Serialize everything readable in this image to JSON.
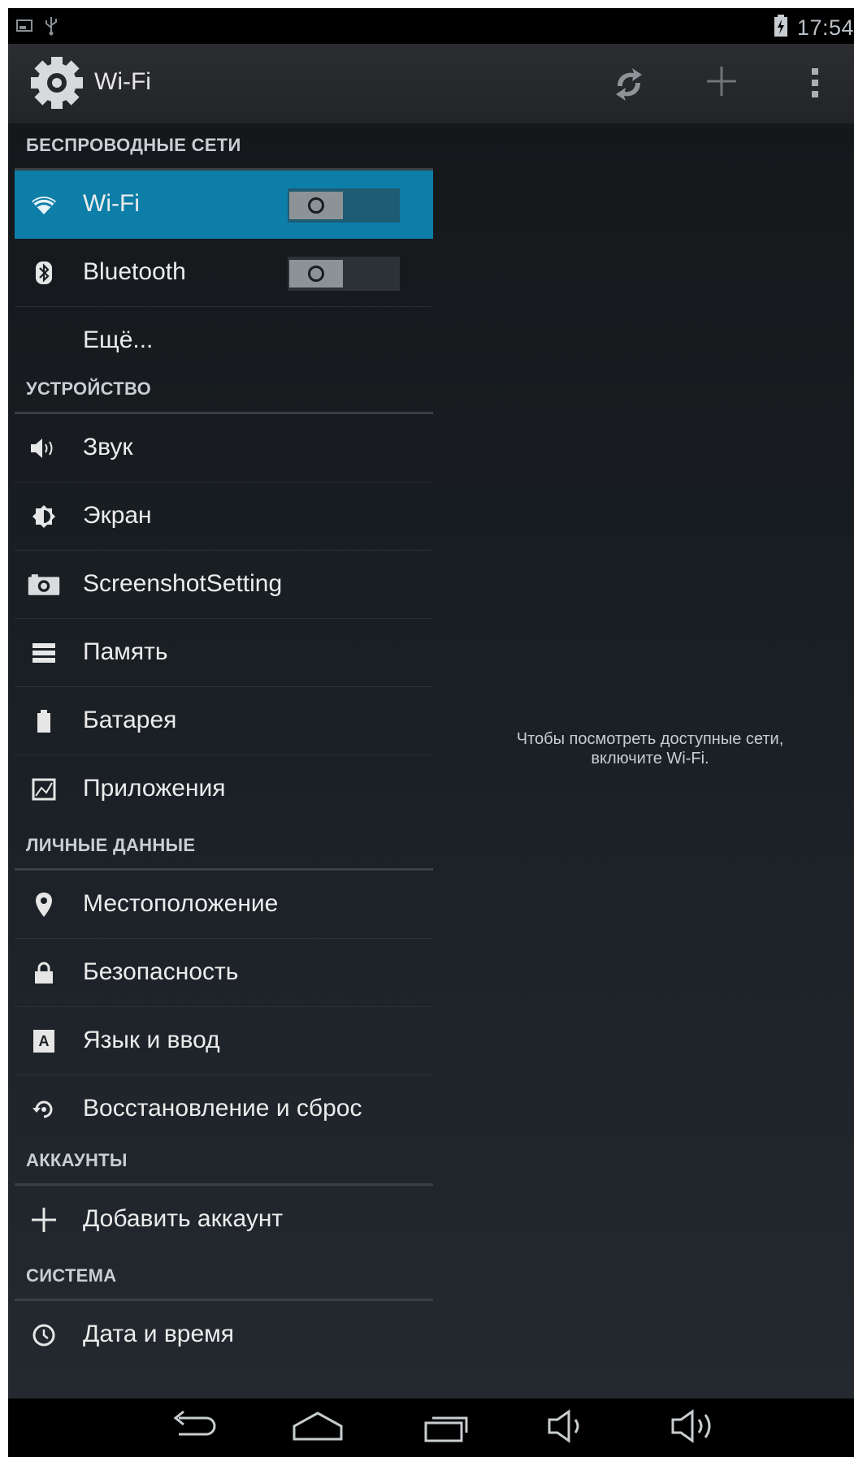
{
  "status_bar": {
    "time": "17:54",
    "icons": [
      "screenshot-notification-icon",
      "usb-icon",
      "battery-charging-icon"
    ]
  },
  "action_bar": {
    "title": "Wi-Fi",
    "icons": [
      "settings-gear-icon",
      "wps-icon",
      "add-icon",
      "overflow-menu-icon"
    ]
  },
  "sections": [
    {
      "header": "БЕСПРОВОДНЫЕ СЕТИ"
    },
    {
      "header": "УСТРОЙСТВО"
    },
    {
      "header": "ЛИЧНЫЕ ДАННЫЕ"
    },
    {
      "header": "АККАУНТЫ"
    },
    {
      "header": "СИСТЕМА"
    }
  ],
  "items": [
    {
      "label": "Wi-Fi",
      "icon": "wifi-icon",
      "selected": true,
      "toggle": "off"
    },
    {
      "label": "Bluetooth",
      "icon": "bluetooth-icon",
      "toggle": "off"
    },
    {
      "label": "Ещё...",
      "icon": ""
    },
    {
      "label": "Звук",
      "icon": "sound-icon"
    },
    {
      "label": "Экран",
      "icon": "display-brightness-icon"
    },
    {
      "label": "ScreenshotSetting",
      "icon": "camera-icon"
    },
    {
      "label": "Память",
      "icon": "storage-icon"
    },
    {
      "label": "Батарея",
      "icon": "battery-icon"
    },
    {
      "label": "Приложения",
      "icon": "apps-icon"
    },
    {
      "label": "Местоположение",
      "icon": "location-pin-icon"
    },
    {
      "label": "Безопасность",
      "icon": "lock-icon"
    },
    {
      "label": "Язык и ввод",
      "icon": "language-input-icon"
    },
    {
      "label": "Восстановление и сброс",
      "icon": "backup-restore-icon"
    },
    {
      "label": "Добавить аккаунт",
      "icon": "add-icon"
    },
    {
      "label": "Дата и время",
      "icon": "clock-icon"
    }
  ],
  "wifi_panel": {
    "message_line1": "Чтобы посмотреть доступные сети,",
    "message_line2": "включите Wi-Fi."
  },
  "nav_bar": {
    "buttons": [
      "back-icon",
      "home-icon",
      "recent-apps-icon",
      "volume-down-icon",
      "volume-up-icon"
    ]
  },
  "colors": {
    "accent": "#0d7ea8",
    "background": "#1b2126"
  }
}
